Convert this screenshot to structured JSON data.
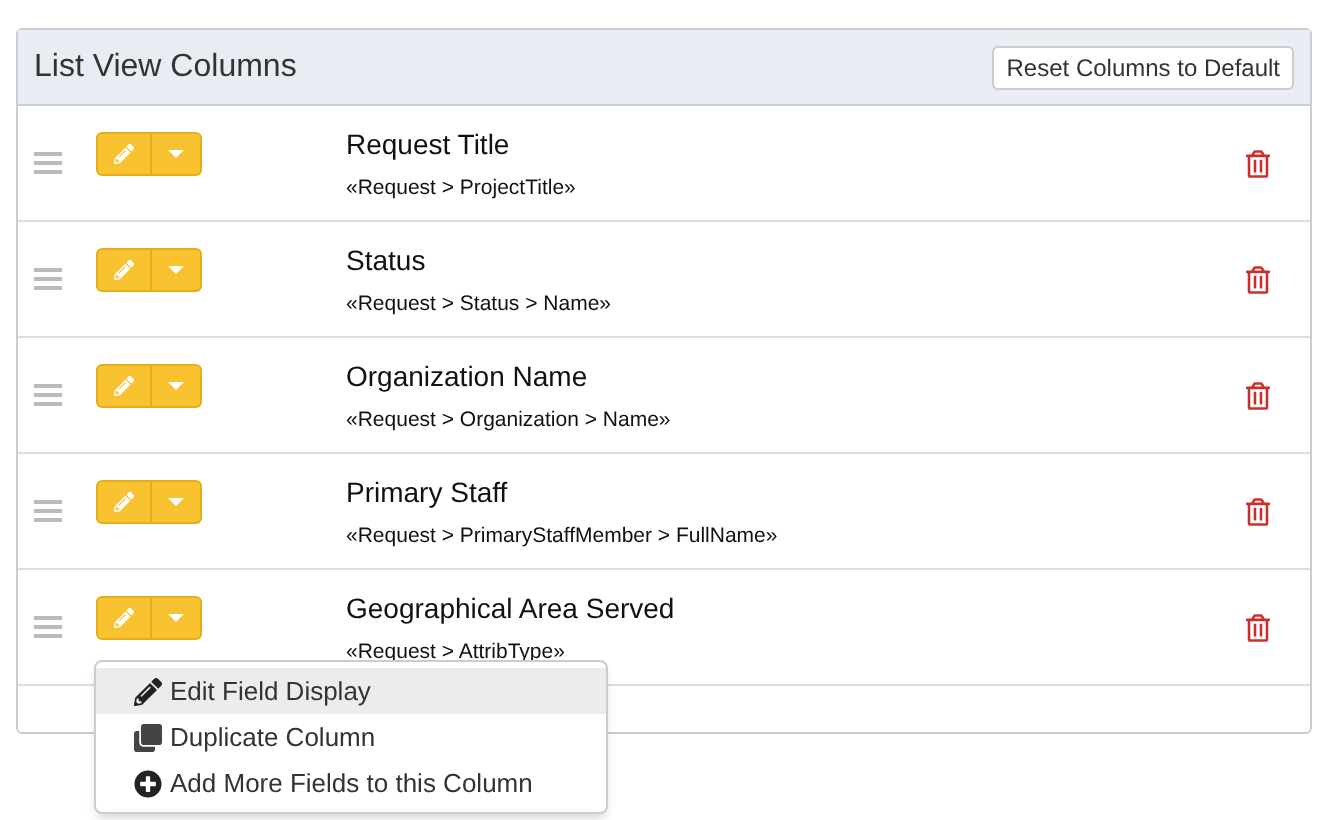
{
  "panel": {
    "title": "List View Columns",
    "reset_button": "Reset Columns to Default"
  },
  "columns": [
    {
      "title": "Request Title",
      "field": "«Request > ProjectTitle»"
    },
    {
      "title": "Status",
      "field": "«Request > Status > Name»"
    },
    {
      "title": "Organization Name",
      "field": "«Request > Organization > Name»"
    },
    {
      "title": "Primary Staff",
      "field": "«Request > PrimaryStaffMember > FullName»"
    },
    {
      "title": "Geographical Area Served",
      "field": "«Request > AttribType»"
    }
  ],
  "menu": {
    "items": [
      {
        "kind": "edit",
        "label": "Edit Field Display",
        "selected": true
      },
      {
        "kind": "duplicate",
        "label": "Duplicate Column",
        "selected": false
      },
      {
        "kind": "add",
        "label": "Add More Fields to this Column",
        "selected": false
      }
    ]
  }
}
